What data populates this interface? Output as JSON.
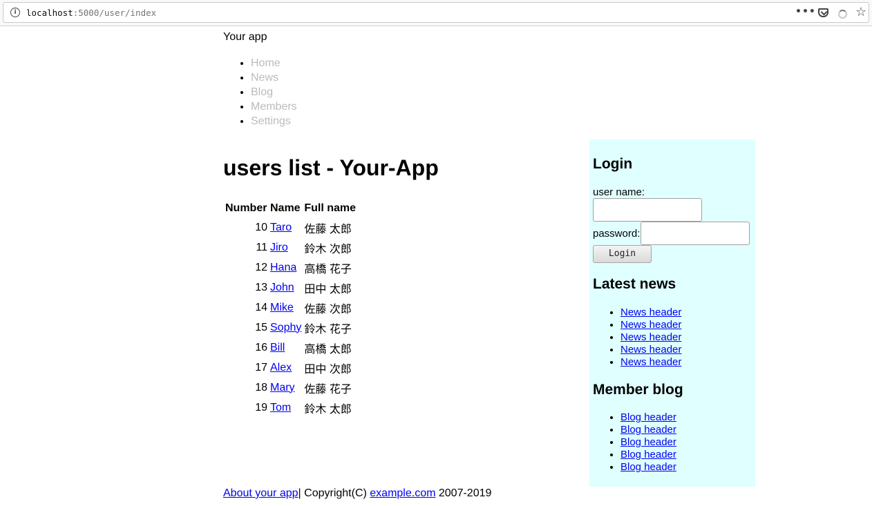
{
  "browser": {
    "url_host": "localhost",
    "url_rest": ":5000/user/index"
  },
  "site": {
    "title": "Your app",
    "nav": [
      "Home",
      "News",
      "Blog",
      "Members",
      "Settings"
    ]
  },
  "main": {
    "heading": "users list - Your-App",
    "table": {
      "headers": [
        "Number",
        "Name",
        "Full name"
      ],
      "rows": [
        {
          "number": "10",
          "name": "Taro",
          "full_name": "佐藤 太郎"
        },
        {
          "number": "11",
          "name": "Jiro",
          "full_name": "鈴木 次郎"
        },
        {
          "number": "12",
          "name": "Hana",
          "full_name": "高橋 花子"
        },
        {
          "number": "13",
          "name": "John",
          "full_name": "田中 太郎"
        },
        {
          "number": "14",
          "name": "Mike",
          "full_name": "佐藤 次郎"
        },
        {
          "number": "15",
          "name": "Sophy",
          "full_name": "鈴木 花子"
        },
        {
          "number": "16",
          "name": "Bill",
          "full_name": "高橋 太郎"
        },
        {
          "number": "17",
          "name": "Alex",
          "full_name": "田中 次郎"
        },
        {
          "number": "18",
          "name": "Mary",
          "full_name": "佐藤 花子"
        },
        {
          "number": "19",
          "name": "Tom",
          "full_name": "鈴木 太郎"
        }
      ]
    }
  },
  "sidebar": {
    "login": {
      "heading": "Login",
      "username_label": "user name:",
      "password_label": "password:",
      "username_value": "",
      "password_value": "",
      "button_label": "Login"
    },
    "news": {
      "heading": "Latest news",
      "items": [
        "News header",
        "News header",
        "News header",
        "News header",
        "News header"
      ]
    },
    "blog": {
      "heading": "Member blog",
      "items": [
        "Blog header",
        "Blog header",
        "Blog header",
        "Blog header",
        "Blog header"
      ]
    },
    "background": "#e0ffff"
  },
  "footer": {
    "about_link": "About your app",
    "copyright_text": "| Copyright(C) ",
    "site_link": "example.com",
    "years": " 2007-2019"
  },
  "colors": {
    "link": "#0000ee",
    "nav_text": "#bbbbbb"
  }
}
